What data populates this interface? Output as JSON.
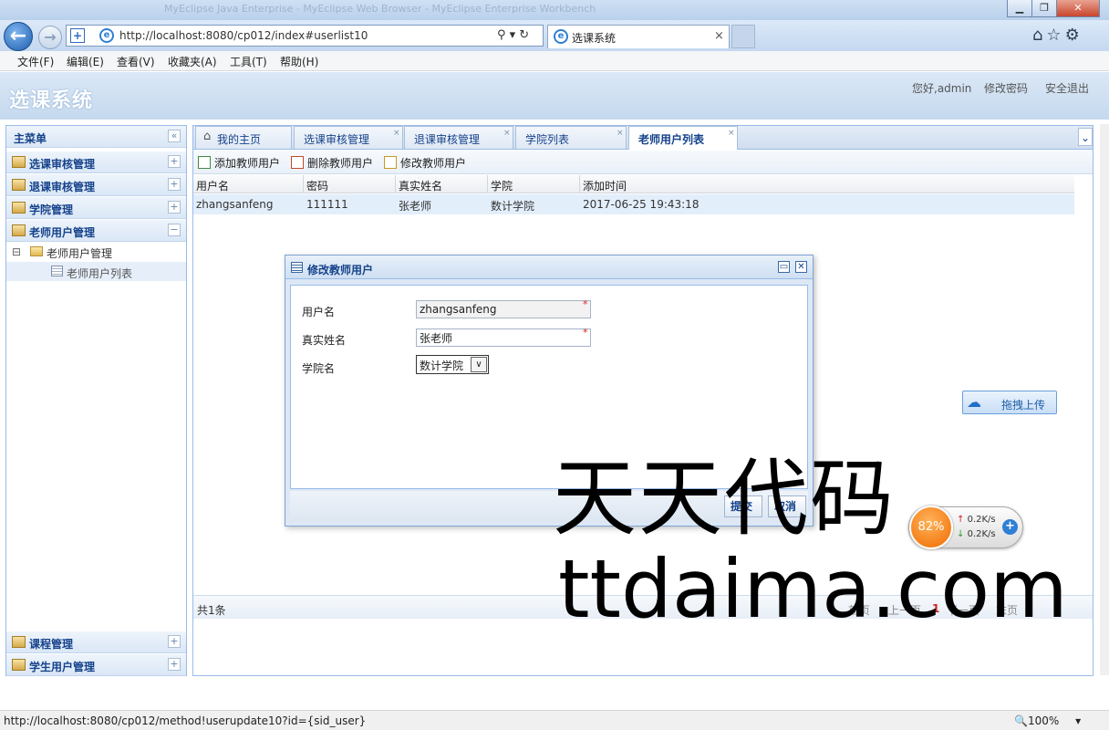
{
  "window": {
    "title": "MyEclipse Java Enterprise - MyEclipse Web Browser - MyEclipse Enterprise Workbench",
    "min_glyph": "▁",
    "max_glyph": "❐",
    "close_glyph": "✕"
  },
  "browser": {
    "url": "http://localhost:8080/cp012/index#userlist10",
    "tab_title": "选课系统",
    "tab_close": "×",
    "url_tools": "⚲ ▾ ↻",
    "right_icons": "⌂☆⚙",
    "back_glyph": "←",
    "forward_glyph": "→",
    "favicon_glyph": "+",
    "ie_glyph": "e"
  },
  "menubar": [
    "文件(F)",
    "编辑(E)",
    "查看(V)",
    "收藏夹(A)",
    "工具(T)",
    "帮助(H)"
  ],
  "app": {
    "title": "选课系统",
    "greeting": "您好,admin",
    "change_password": "修改密码",
    "logout": "安全退出"
  },
  "sidebar": {
    "header": "主菜单",
    "collapse_glyph": "«",
    "expand_glyph": "+",
    "collapse_item_glyph": "−",
    "items": [
      {
        "label": "选课审核管理"
      },
      {
        "label": "退课审核管理"
      },
      {
        "label": "学院管理"
      },
      {
        "label": "老师用户管理"
      }
    ],
    "tree": {
      "toggle": "⊟",
      "folder": "老师用户管理",
      "leaf": "老师用户列表"
    },
    "bottom_items": [
      {
        "label": "课程管理"
      },
      {
        "label": "学生用户管理"
      }
    ]
  },
  "tabs": [
    {
      "label": "我的主页",
      "icon": "home-icon",
      "glyph": "⌂"
    },
    {
      "label": "选课审核管理"
    },
    {
      "label": "退课审核管理"
    },
    {
      "label": "学院列表"
    },
    {
      "label": "老师用户列表"
    }
  ],
  "tab_close_glyph": "×",
  "tab_menu_glyph": "⌄",
  "toolbar": {
    "add": "添加教师用户",
    "delete": "删除教师用户",
    "edit": "修改教师用户"
  },
  "grid": {
    "columns": [
      "用户名",
      "密码",
      "真实姓名",
      "学院",
      "添加时间"
    ],
    "rows": [
      [
        "zhangsanfeng",
        "111111",
        "张老师",
        "数计学院",
        "2017-06-25 19:43:18"
      ]
    ],
    "total": "共1条",
    "pager": {
      "first": "首页",
      "prev": "上一页",
      "current": "1",
      "next": "下一页",
      "last": "末页"
    }
  },
  "dialog": {
    "title": "修改教师用户",
    "restore_glyph": "▭",
    "close_glyph": "✕",
    "fields": {
      "username_label": "用户名",
      "username_value": "zhangsanfeng",
      "realname_label": "真实姓名",
      "realname_value": "张老师",
      "college_label": "学院名",
      "college_value": "数计学院",
      "required_mark": "*",
      "select_arrow": "∨"
    },
    "submit": "提交",
    "cancel": "取消"
  },
  "upload": {
    "label": "拖拽上传",
    "glyph": "☁"
  },
  "speed": {
    "percent": "82%",
    "up": "0.2K/s",
    "down": "0.2K/s",
    "up_arrow": "↑",
    "down_arrow": "↓",
    "plus": "+"
  },
  "watermark": {
    "line1": "天天代码",
    "line2": "ttdaima.com"
  },
  "statusbar": {
    "text": "http://localhost:8080/cp012/method!userupdate10?id={sid_user}",
    "zoom": "🔍100%",
    "zoom_arrow": "▾"
  },
  "colors": {
    "accent": "#15428b",
    "border": "#99bbe8",
    "required": "#e02020"
  }
}
